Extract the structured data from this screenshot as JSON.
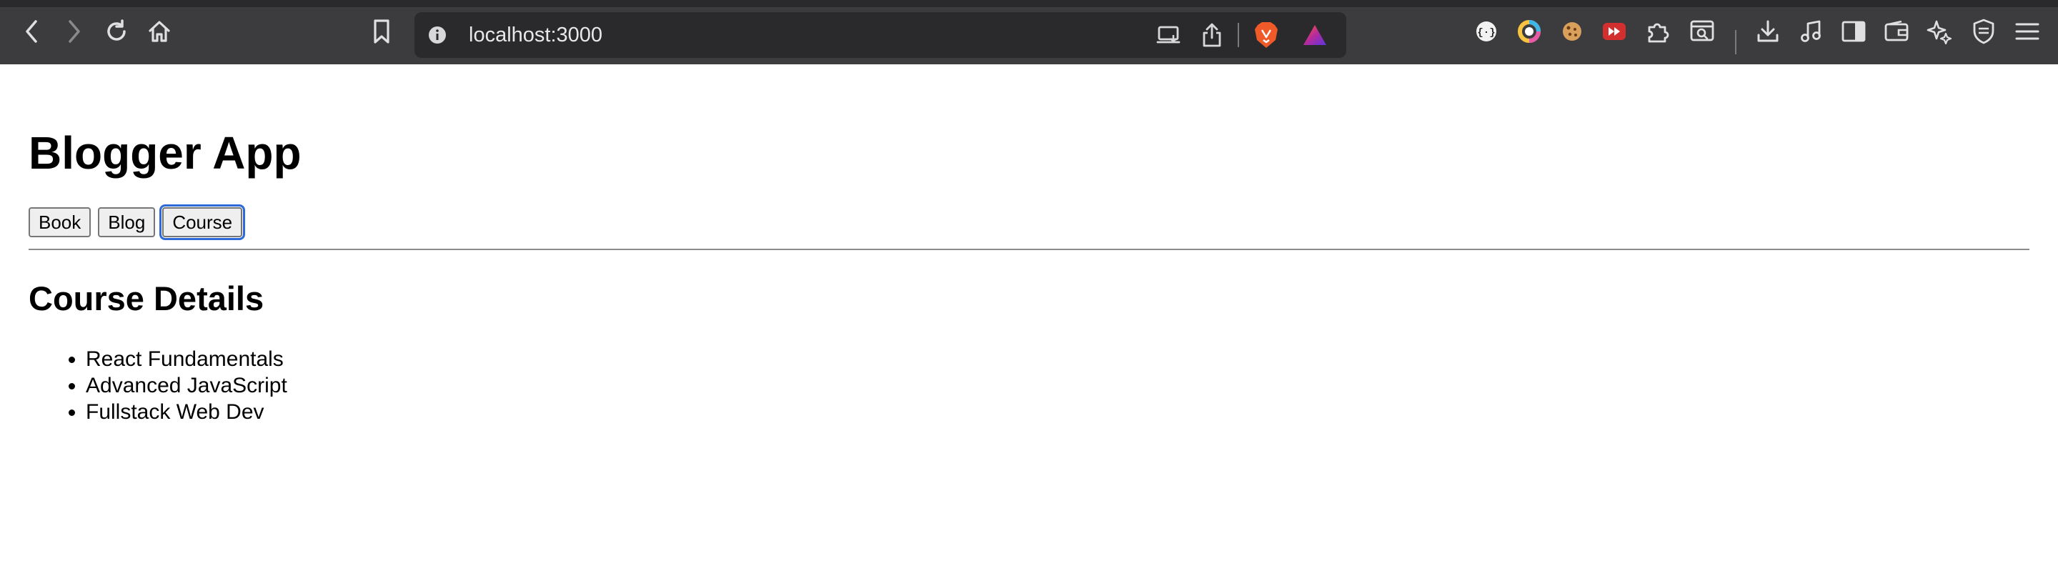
{
  "browser": {
    "url": "localhost:3000",
    "toolbar_icons": {
      "back": "chevron-left-icon",
      "forward": "chevron-right-icon",
      "reload": "reload-icon",
      "home": "home-icon",
      "bookmark": "bookmark-icon",
      "site_info": "info-icon",
      "cast": "cast-icon",
      "share": "share-icon",
      "brave_shields": "brave-lion-icon",
      "brave_rewards": "rewards-triangle-icon"
    },
    "extensions": [
      "json-viewer-icon",
      "color-picker-icon",
      "cookie-icon",
      "video-speed-icon",
      "extensions-puzzle-icon",
      "reader-search-icon",
      "download-icon",
      "media-music-icon",
      "sidebar-icon",
      "wallet-icon",
      "leo-ai-icon",
      "vpn-shield-icon",
      "menu-icon"
    ]
  },
  "page": {
    "title": "Blogger App",
    "nav_buttons": [
      {
        "label": "Book",
        "focused": false
      },
      {
        "label": "Blog",
        "focused": false
      },
      {
        "label": "Course",
        "focused": true
      }
    ],
    "section_title": "Course Details",
    "courses": [
      "React Fundamentals",
      "Advanced JavaScript",
      "Fullstack Web Dev"
    ]
  },
  "colors": {
    "toolbar_bg": "#3c3c3f",
    "url_bar_bg": "#2a2a2d",
    "focus_ring": "#2d6ad8",
    "brave_orange": "#f05a28"
  }
}
